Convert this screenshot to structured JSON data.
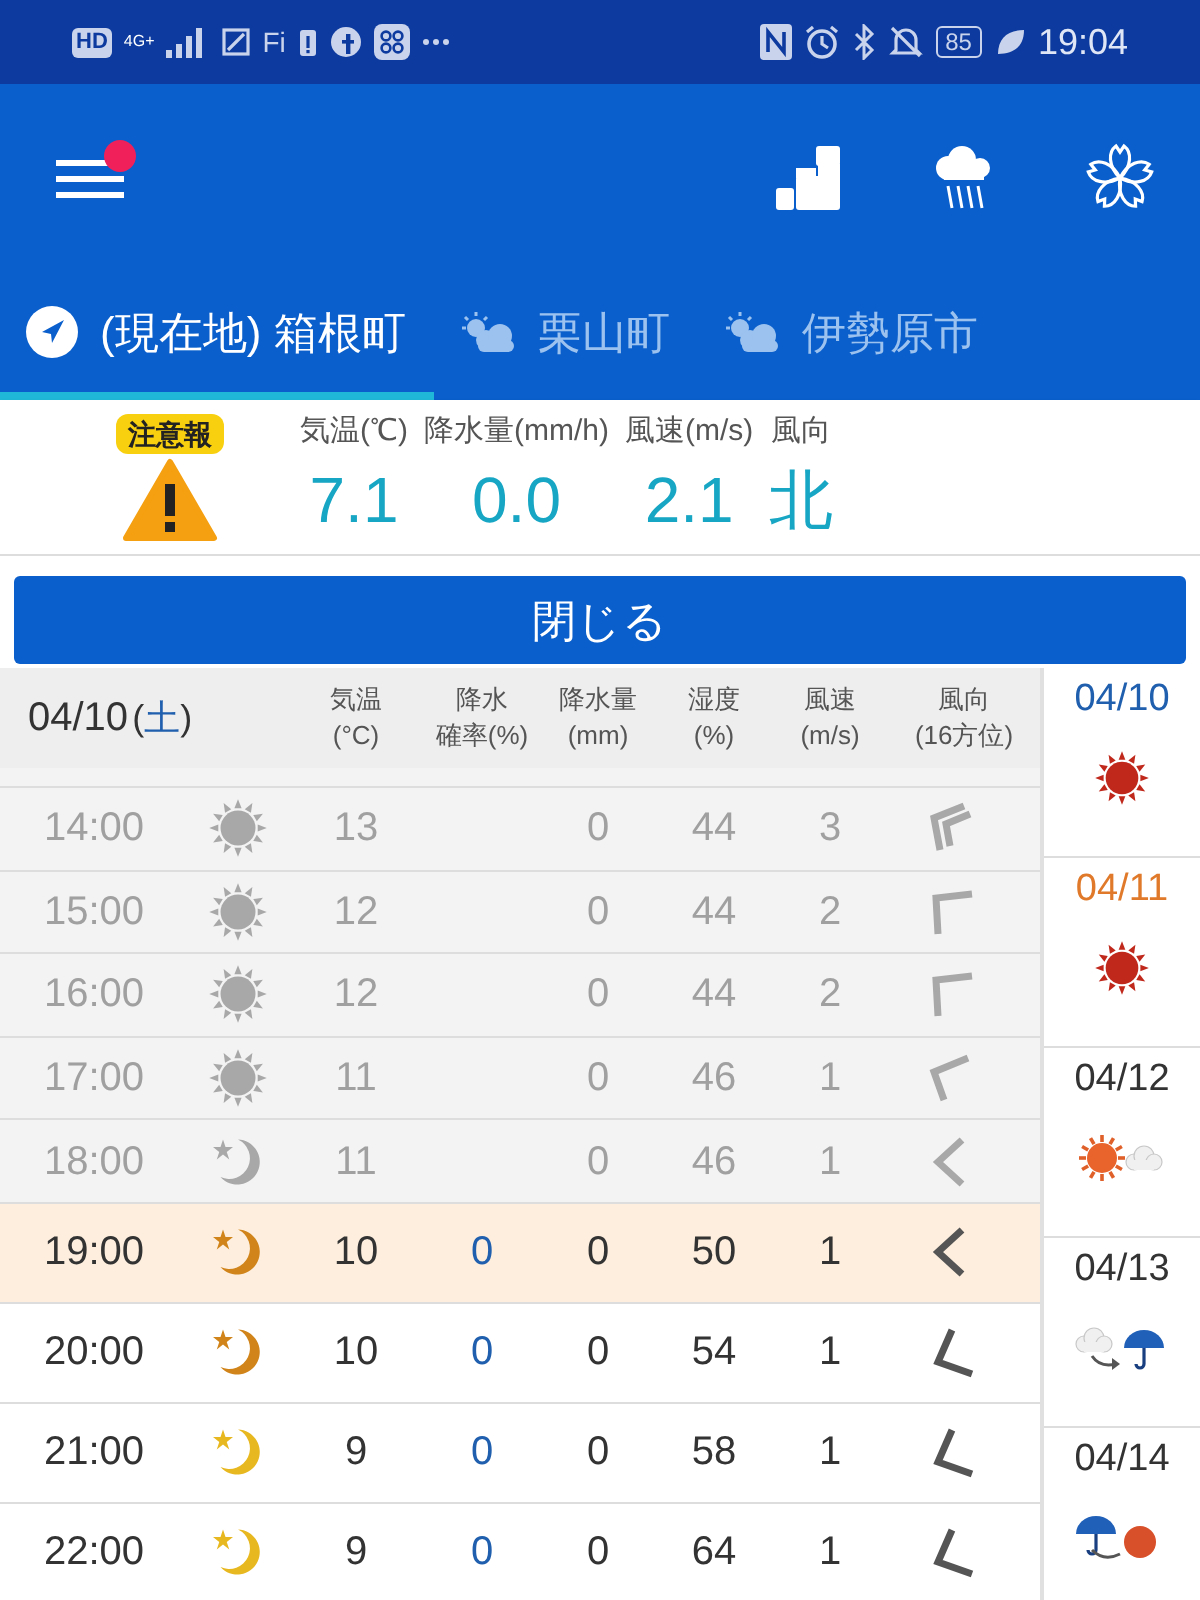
{
  "status_bar": {
    "network": "HD",
    "signal_label": "4G+",
    "wifi_label": "Fi",
    "battery": "85",
    "time": "19:04"
  },
  "tabs": [
    {
      "label": "(現在地) 箱根町",
      "kind": "location",
      "selected": true
    },
    {
      "label": "栗山町",
      "kind": "weather",
      "selected": false
    },
    {
      "label": "伊勢原市",
      "kind": "weather",
      "selected": false
    }
  ],
  "current": {
    "alert": "注意報",
    "readings": [
      {
        "label": "気温(℃)",
        "value": "7.1"
      },
      {
        "label": "降水量(mm/h)",
        "value": "0.0"
      },
      {
        "label": "風速(m/s)",
        "value": "2.1"
      },
      {
        "label": "風向",
        "value": "北"
      }
    ]
  },
  "close_button": "閉じる",
  "table": {
    "date": "04/10",
    "weekday_open": "(",
    "weekday": "土",
    "weekday_close": ")",
    "columns": [
      [
        "気温",
        "(°C)"
      ],
      [
        "降水",
        "確率(%)"
      ],
      [
        "降水量",
        "(mm)"
      ],
      [
        "湿度",
        "(%)"
      ],
      [
        "風速",
        "(m/s)"
      ],
      [
        "風向",
        "(16方位)"
      ]
    ],
    "rows": [
      {
        "time": "14:00",
        "temp": "13",
        "amount": "0",
        "humidity": "44",
        "wind": "3",
        "past": true,
        "selected": false
      },
      {
        "time": "15:00",
        "temp": "12",
        "amount": "0",
        "humidity": "44",
        "wind": "2",
        "past": true,
        "selected": false
      },
      {
        "time": "16:00",
        "temp": "12",
        "amount": "0",
        "humidity": "44",
        "wind": "2",
        "past": true,
        "selected": false
      },
      {
        "time": "17:00",
        "temp": "11",
        "amount": "0",
        "humidity": "46",
        "wind": "1",
        "past": true,
        "selected": false
      },
      {
        "time": "18:00",
        "temp": "11",
        "amount": "0",
        "humidity": "46",
        "wind": "1",
        "past": true,
        "selected": false
      },
      {
        "time": "19:00",
        "temp": "10",
        "probability": "0",
        "amount": "0",
        "humidity": "50",
        "wind": "1",
        "past": false,
        "selected": true
      },
      {
        "time": "20:00",
        "temp": "10",
        "probability": "0",
        "amount": "0",
        "humidity": "54",
        "wind": "1",
        "past": false,
        "selected": false
      },
      {
        "time": "21:00",
        "temp": "9",
        "probability": "0",
        "amount": "0",
        "humidity": "58",
        "wind": "1",
        "past": false,
        "selected": false
      },
      {
        "time": "22:00",
        "temp": "9",
        "probability": "0",
        "amount": "0",
        "humidity": "64",
        "wind": "1",
        "past": false,
        "selected": false
      }
    ]
  },
  "days": [
    {
      "date": "04/10",
      "color": "#1f5fae"
    },
    {
      "date": "04/11",
      "color": "#e07a2a"
    },
    {
      "date": "04/12",
      "color": "#333333"
    },
    {
      "date": "04/13",
      "color": "#333333"
    },
    {
      "date": "04/14",
      "color": "#333333"
    }
  ]
}
